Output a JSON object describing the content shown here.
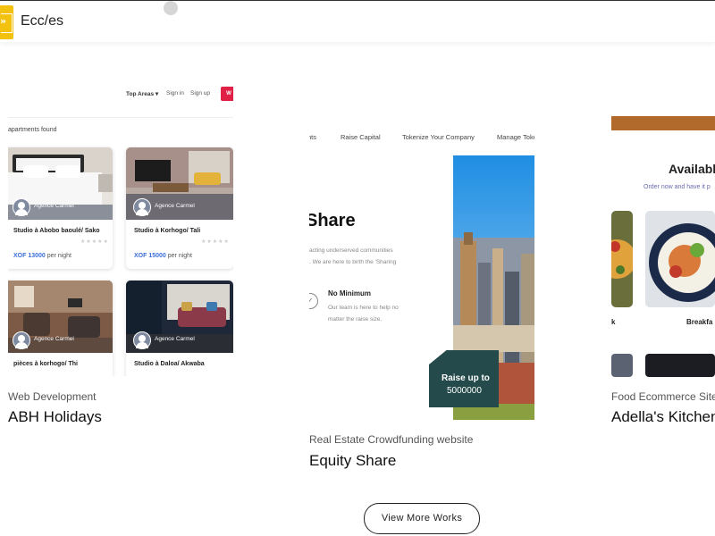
{
  "header": {
    "brand": "Ecc/es",
    "logo_symbol": "»"
  },
  "works": [
    {
      "category": "Web Development",
      "title": "ABH Holidays",
      "shot": {
        "nav": {
          "top_areas": "Top Areas ▾",
          "sign_in": "Sign in",
          "sign_up": "Sign up",
          "accent_button": "W"
        },
        "found_text": "apartments found",
        "listings": [
          {
            "agent": "Agence Carmel",
            "title": "Studio à Abobo baoulé/ Sako",
            "price": "XOF 13000",
            "per": " per night"
          },
          {
            "agent": "Agence Carmel",
            "title": "Studio à Korhogo/ Tali",
            "price": "XOF 15000",
            "per": " per night"
          },
          {
            "agent": "Agence Carmel",
            "title": "pièces à korhogo/ Thi"
          },
          {
            "agent": "Agence Carmel",
            "title": "Studio à Daloa/ Akwaba"
          }
        ],
        "stars": "★★★★★"
      }
    },
    {
      "category": "Real Estate Crowdfunding website",
      "title": "Equity Share",
      "shot": {
        "nav": [
          "nts",
          "Raise Capital",
          "Tokenize Your Company",
          "Manage Toke"
        ],
        "hero_title": "Share",
        "hero_sub_1": "acting underserved communities",
        "hero_sub_2": ". We are here to birth the 'Sharing",
        "feature_title": "No Minimum",
        "feature_text_1": "Our team is here to help no",
        "feature_text_2": "matter the raise size.",
        "badge_line1": "Raise up to",
        "badge_line2": "5000000"
      }
    },
    {
      "category": "Food Ecommerce Site",
      "title": "Adella's Kitchen",
      "shot": {
        "heading": "Availabl",
        "subheading": "Order now and have it p",
        "caption_left": "k",
        "caption_right": "Breakfa"
      }
    }
  ],
  "cta": {
    "label": "View More Works"
  },
  "colors": {
    "logo_yellow": "#f2c20f",
    "price_blue": "#3b6fd8",
    "accent_red": "#e02045",
    "badge_teal": "#244a4b"
  }
}
